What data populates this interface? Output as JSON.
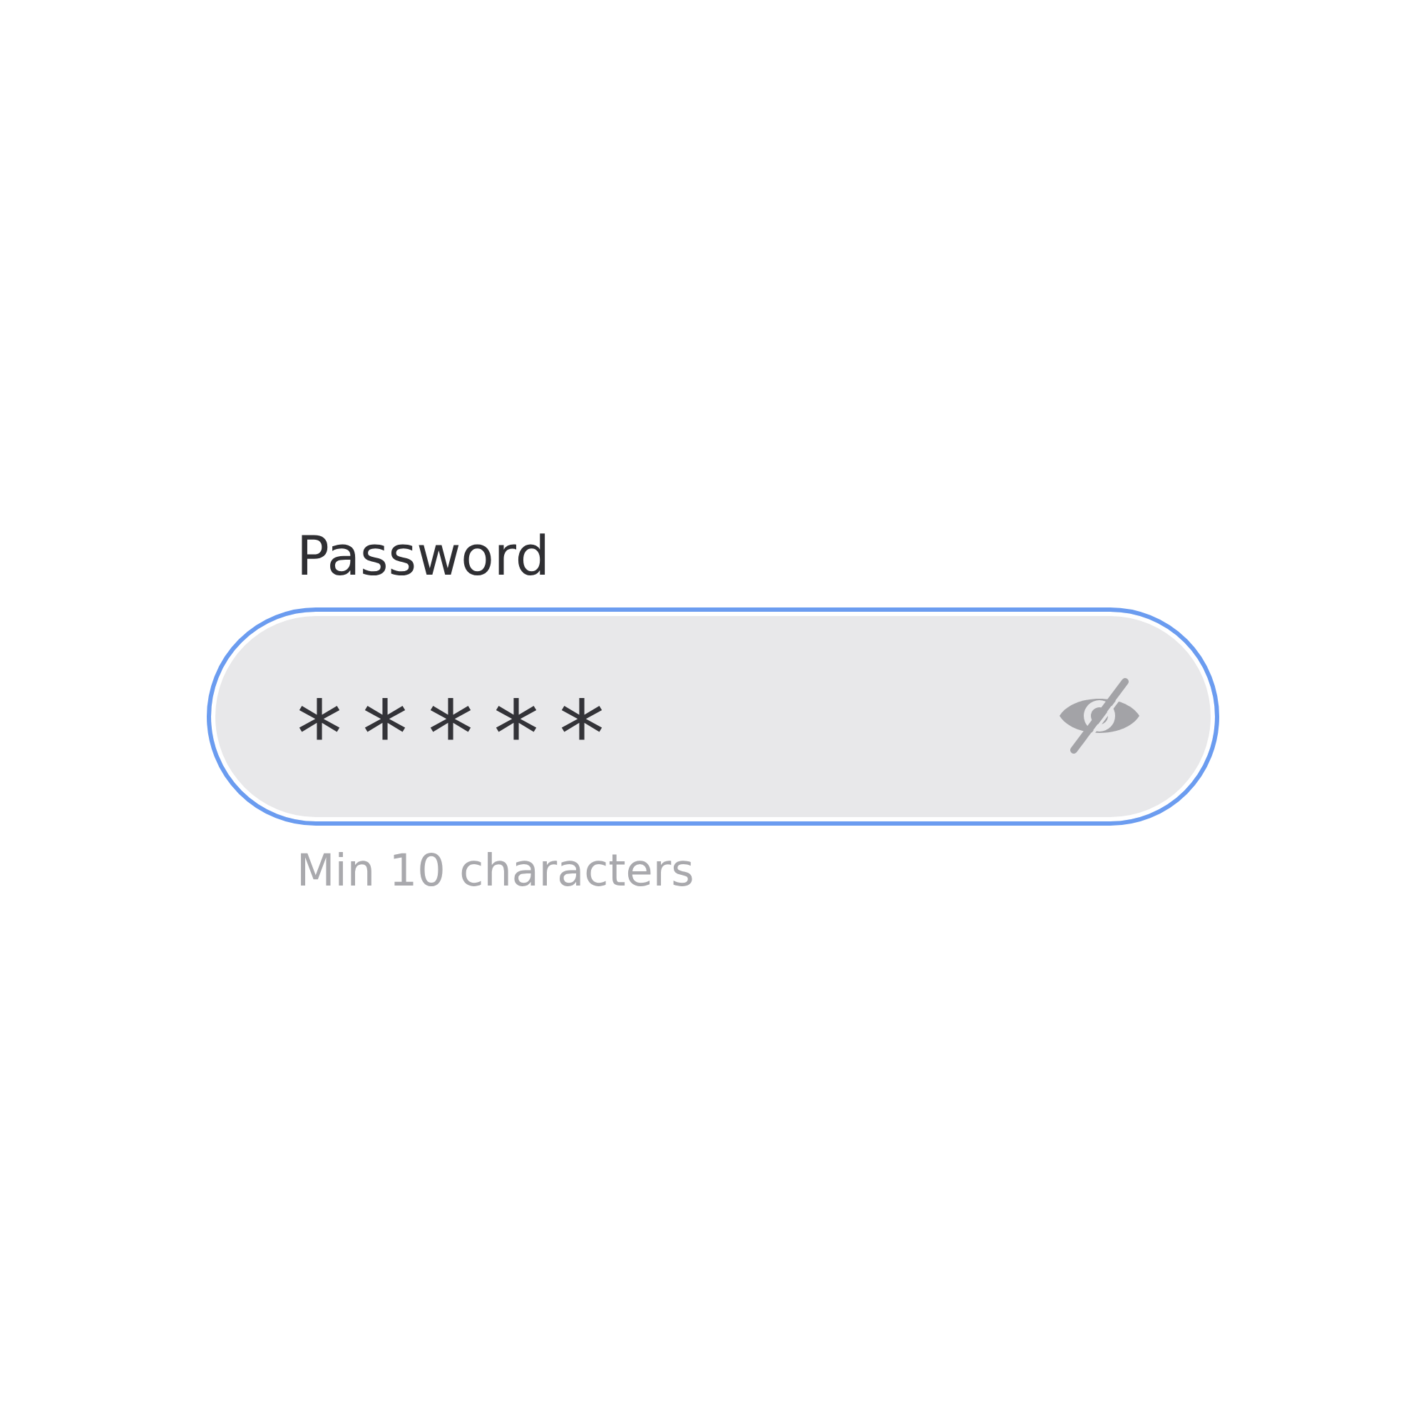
{
  "label": "Password",
  "field": {
    "value": "*****",
    "password_visible": false
  },
  "hint": "Min 10 characters"
}
